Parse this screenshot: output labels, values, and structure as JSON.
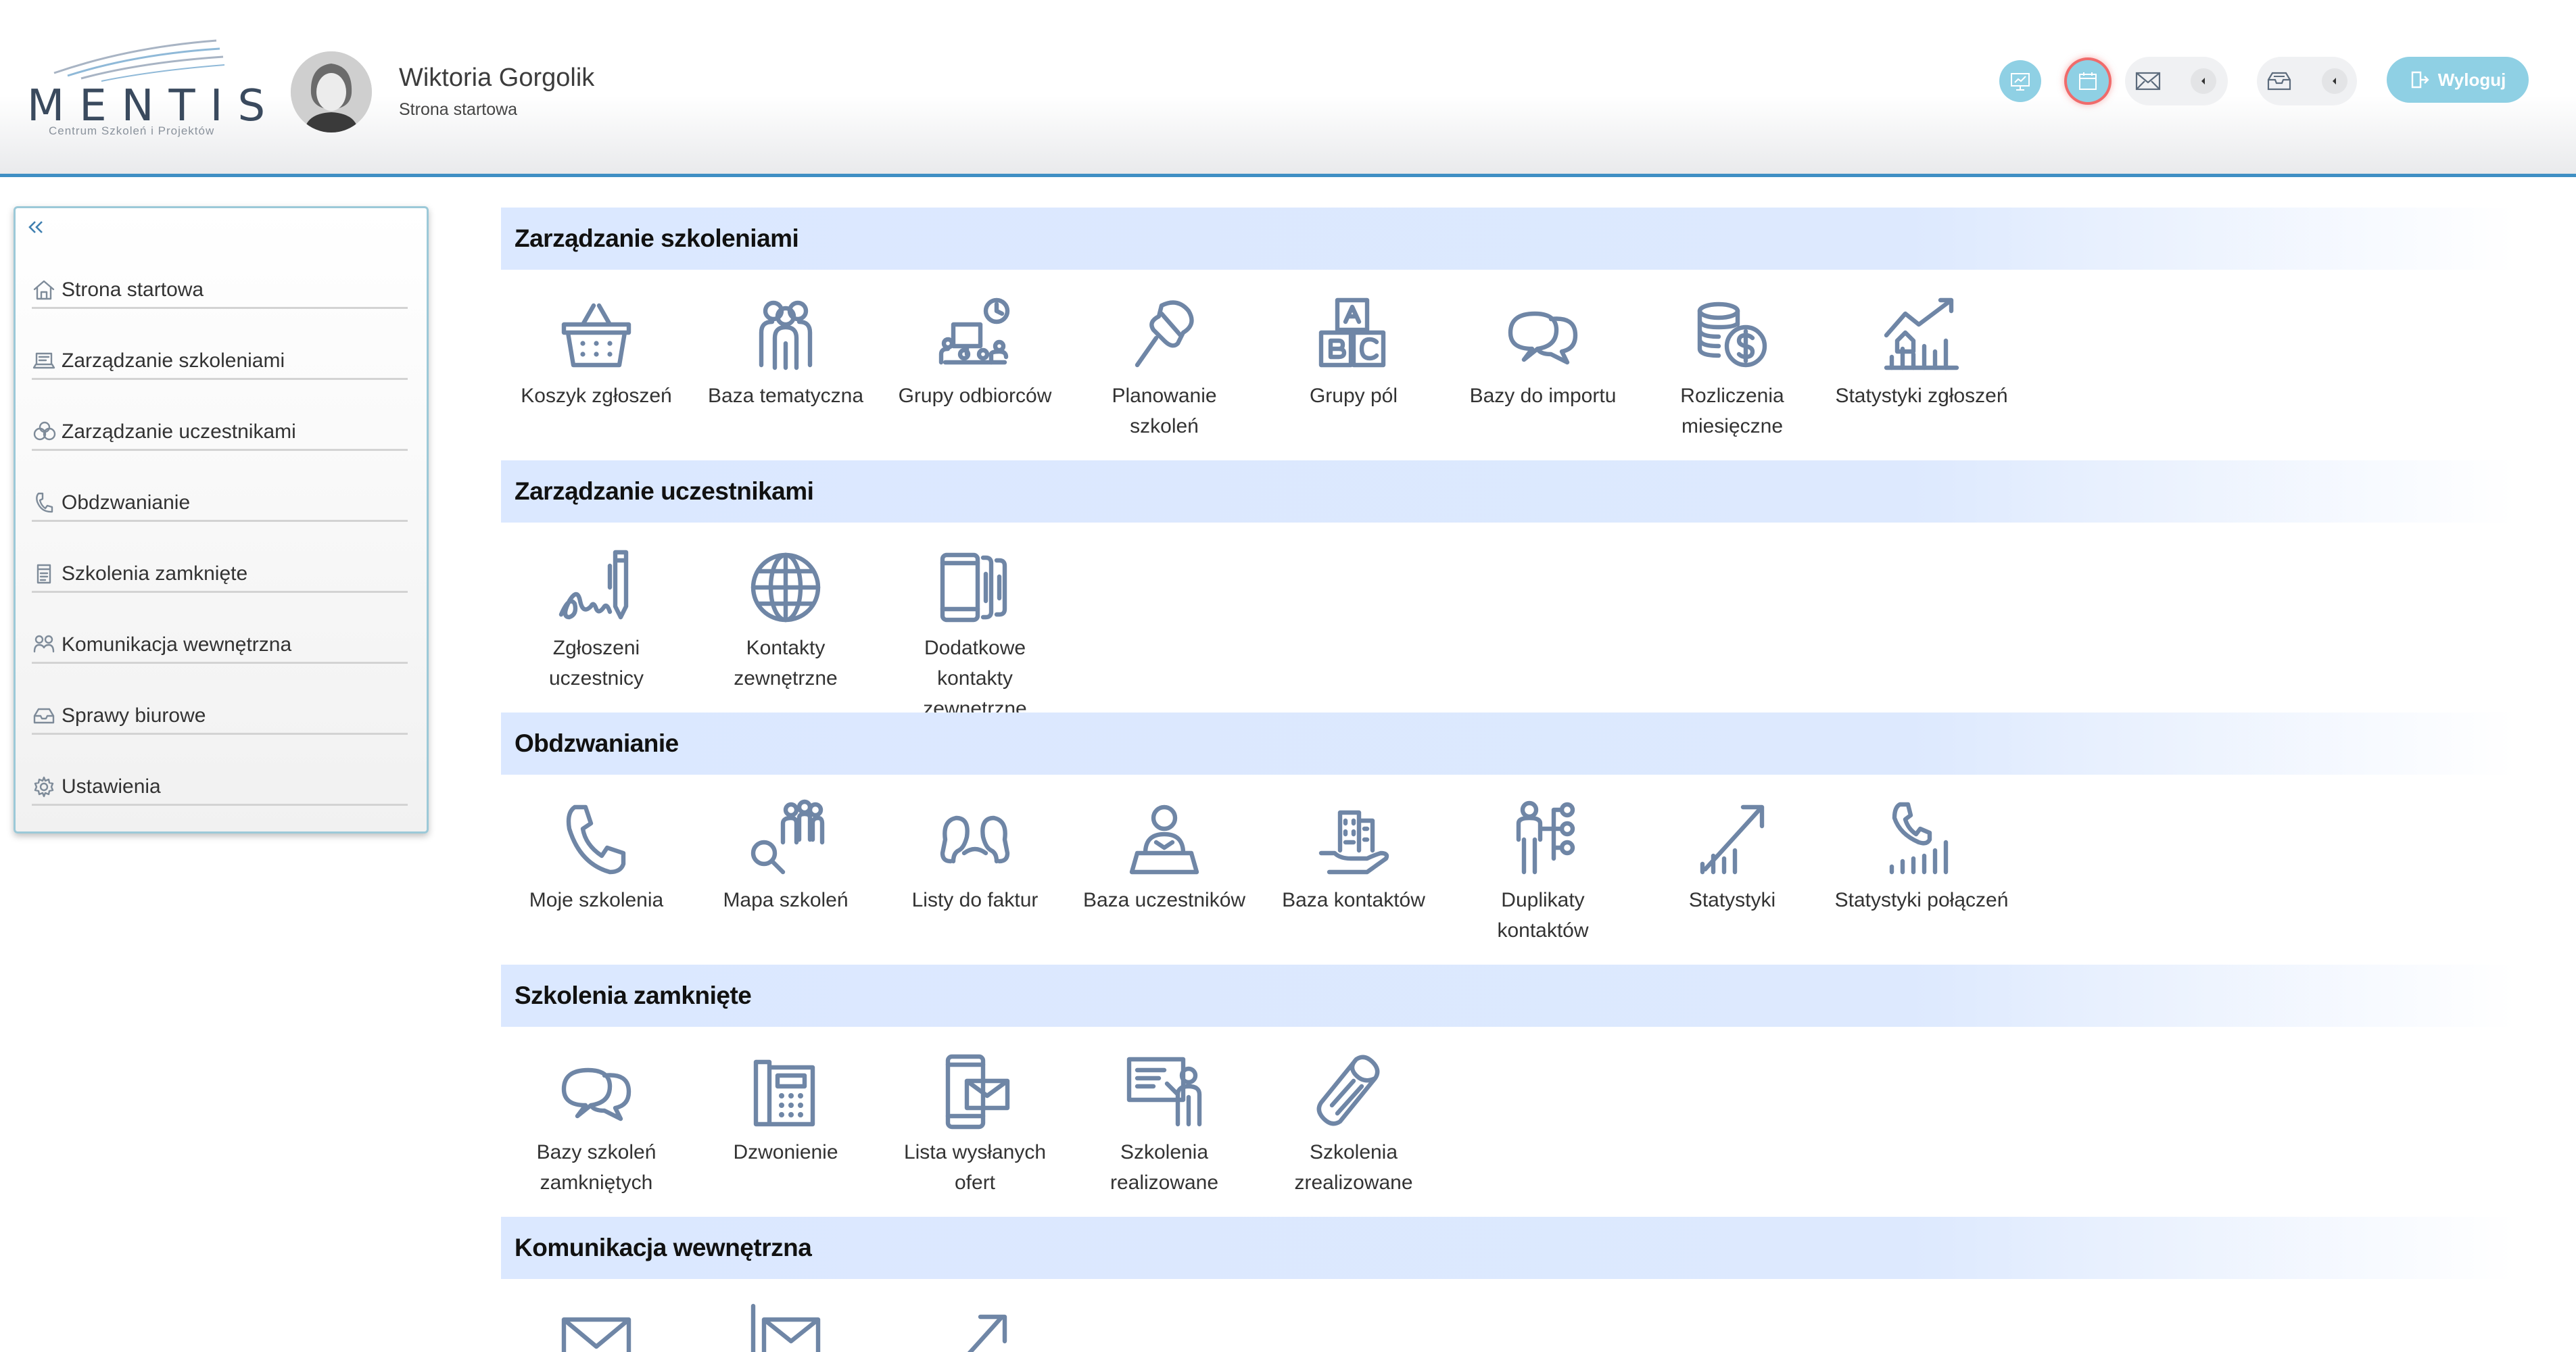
{
  "header": {
    "logo_text": "MENTIS",
    "logo_subtitle": "Centrum Szkoleń i Projektów",
    "user_name": "Wiktoria Gorgolik",
    "current_page": "Strona startowa",
    "logout_label": "Wyloguj"
  },
  "sidebar": {
    "items": [
      {
        "label": "Strona startowa",
        "icon": "home-icon"
      },
      {
        "label": "Zarządzanie szkoleniami",
        "icon": "laptop-icon"
      },
      {
        "label": "Zarządzanie uczestnikami",
        "icon": "users-icon"
      },
      {
        "label": "Obdzwanianie",
        "icon": "phone-icon"
      },
      {
        "label": "Szkolenia zamknięte",
        "icon": "book-icon"
      },
      {
        "label": "Komunikacja wewnętrzna",
        "icon": "people-icon"
      },
      {
        "label": "Sprawy biurowe",
        "icon": "inbox-icon"
      },
      {
        "label": "Ustawienia",
        "icon": "gear-icon"
      }
    ]
  },
  "sections": [
    {
      "title": "Zarządzanie szkoleniami",
      "tiles": [
        {
          "label": "Koszyk zgłoszeń",
          "icon": "basket-icon"
        },
        {
          "label": "Baza tematyczna",
          "icon": "group-icon"
        },
        {
          "label": "Grupy odbiorców",
          "icon": "audience-icon"
        },
        {
          "label": "Planowanie szkoleń",
          "icon": "pin-icon"
        },
        {
          "label": "Grupy pól",
          "icon": "abc-blocks-icon"
        },
        {
          "label": "Bazy do importu",
          "icon": "chat-bubbles-icon"
        },
        {
          "label": "Rozliczenia miesięczne",
          "icon": "coins-icon"
        },
        {
          "label": "Statystyki zgłoszeń",
          "icon": "growth-chart-icon"
        }
      ]
    },
    {
      "title": "Zarządzanie uczestnikami",
      "tiles": [
        {
          "label": "Zgłoszeni uczestnicy",
          "icon": "signature-icon"
        },
        {
          "label": "Kontakty zewnętrzne",
          "icon": "globe-icon"
        },
        {
          "label": "Dodatkowe kontakty zewnętrzne",
          "icon": "phones-icon"
        }
      ]
    },
    {
      "title": "Obdzwanianie",
      "tiles": [
        {
          "label": "Moje szkolenia",
          "icon": "phone-handset-icon"
        },
        {
          "label": "Mapa szkoleń",
          "icon": "search-people-icon"
        },
        {
          "label": "Listy do faktur",
          "icon": "two-people-icon"
        },
        {
          "label": "Baza uczestników",
          "icon": "person-desk-icon"
        },
        {
          "label": "Baza kontaktów",
          "icon": "building-hand-icon"
        },
        {
          "label": "Duplikaty kontaktów",
          "icon": "org-person-icon"
        },
        {
          "label": "Statystyki",
          "icon": "trend-arrow-icon"
        },
        {
          "label": "Statystyki połączeń",
          "icon": "phone-signal-icon"
        }
      ]
    },
    {
      "title": "Szkolenia zamknięte",
      "tiles": [
        {
          "label": "Bazy szkoleń zamkniętych",
          "icon": "chat-bubbles-icon"
        },
        {
          "label": "Dzwonienie",
          "icon": "desk-phone-icon"
        },
        {
          "label": "Lista wysłanych ofert",
          "icon": "mobile-mail-icon"
        },
        {
          "label": "Szkolenia realizowane",
          "icon": "presenter-icon"
        },
        {
          "label": "Szkolenia zrealizowane",
          "icon": "diploma-icon"
        }
      ]
    },
    {
      "title": "Komunikacja wewnętrzna",
      "tiles": [
        {
          "label": "",
          "icon": "envelope-icon"
        },
        {
          "label": "",
          "icon": "mail-list-icon"
        },
        {
          "label": "",
          "icon": "share-arrow-icon"
        }
      ]
    }
  ],
  "colors": {
    "accent": "#3f8fc4",
    "section_bg": "#dbe8ff",
    "icon": "#6f86a6",
    "logout_bg": "#8fd0e4"
  }
}
